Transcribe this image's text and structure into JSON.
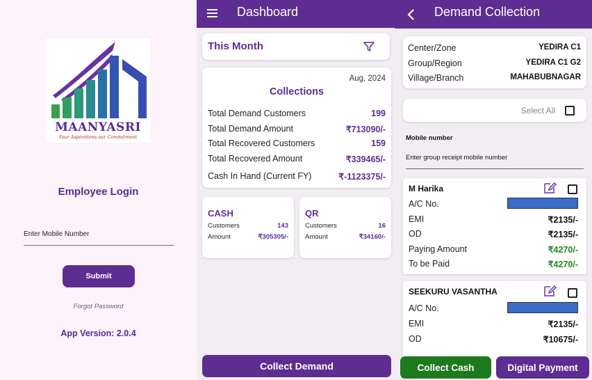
{
  "login": {
    "logo_name": "MAANYASRI",
    "logo_tagline": "Your Aspirations our Commitment",
    "title": "Employee Login",
    "mobile_label": "Enter Mobile Number",
    "submit_label": "Submit",
    "forgot_label": "Forgot Password",
    "app_version": "App Version: 2.0.4"
  },
  "dashboard": {
    "appbar_title": "Dashboard",
    "period_title": "This Month",
    "collections": {
      "date": "Aug, 2024",
      "title": "Collections",
      "rows": [
        {
          "label": "Total Demand Customers",
          "value": "199"
        },
        {
          "label": "Total Demand Amount",
          "value": "₹713090/-"
        },
        {
          "label": "Total Recovered Customers",
          "value": "159"
        },
        {
          "label": "Total Recovered Amount",
          "value": "₹339465/-"
        },
        {
          "label": "Cash In Hand (Current FY)",
          "value": "₹-1123375/-"
        }
      ]
    },
    "cash": {
      "title": "CASH",
      "customers_label": "Customers",
      "customers_value": "143",
      "amount_label": "Amount",
      "amount_value": "₹305305/-"
    },
    "qr": {
      "title": "QR",
      "customers_label": "Customers",
      "customers_value": "16",
      "amount_label": "Amount",
      "amount_value": "₹34160/-"
    },
    "collect_button": "Collect Demand"
  },
  "demand": {
    "appbar_title": "Demand Collection",
    "info": [
      {
        "label": "Center/Zone",
        "value": "YEDIRA C1"
      },
      {
        "label": "Group/Region",
        "value": "YEDIRA C1 G2"
      },
      {
        "label": "Village/Branch",
        "value": "MAHABUBNAGAR"
      }
    ],
    "select_all": "Select All",
    "mobile_label": "Mobile number",
    "mobile_placeholder": "Enter group receipt mobile number",
    "customers": [
      {
        "name": "M Harika",
        "acno_label": "A/C No.",
        "emi_label": "EMI",
        "emi": "₹2135/-",
        "od_label": "OD",
        "od": "₹2135/-",
        "paying_label": "Paying Amount",
        "paying": "₹4270/-",
        "tobepaid_label": "To be Paid",
        "tobepaid": "₹4270/-"
      },
      {
        "name": "SEEKURU VASANTHA",
        "acno_label": "A/C No.",
        "emi_label": "EMI",
        "emi": "₹2135/-",
        "od_label": "OD",
        "od": "₹10675/-"
      }
    ],
    "collect_cash_button": "Collect Cash",
    "digital_payment_button": "Digital Payment"
  },
  "colors": {
    "brand_purple": "#5e2d91",
    "green_button": "#1e7a1e",
    "amount_green": "#1e8a1e",
    "redaction_blue": "#3a6cc8"
  }
}
